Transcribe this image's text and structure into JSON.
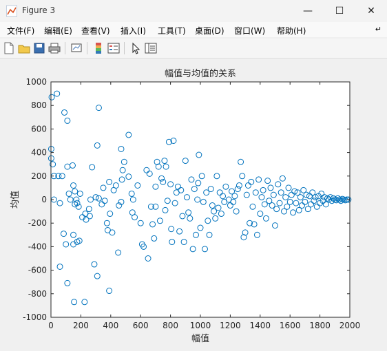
{
  "window": {
    "title": "Figure 3"
  },
  "menu": [
    "文件(F)",
    "编辑(E)",
    "查看(V)",
    "插入(I)",
    "工具(T)",
    "桌面(D)",
    "窗口(W)",
    "帮助(H)"
  ],
  "toolbar": [
    "new-figure-icon",
    "open-file-icon",
    "save-icon",
    "print-icon",
    "link-plot-icon",
    "colorbar-icon",
    "legend-icon",
    "pointer-icon",
    "property-inspector-icon"
  ],
  "colors": {
    "marker": "#0072bd",
    "axes_bg": "#ffffff",
    "figure_bg": "#f0f0f0"
  },
  "chart_data": {
    "type": "scatter",
    "title": "幅值与均值的关系",
    "xlabel": "幅值",
    "ylabel": "均值",
    "xlim": [
      0,
      2000
    ],
    "ylim": [
      -1000,
      1000
    ],
    "xticks": [
      "0",
      "200",
      "400",
      "600",
      "800",
      "1000",
      "1200",
      "1400",
      "1600",
      "1800",
      "2000"
    ],
    "yticks": [
      "1000",
      "800",
      "600",
      "400",
      "200",
      "0",
      "-200",
      "-400",
      "-600",
      "-800",
      "-1000"
    ],
    "marker": "open-circle",
    "grid": false,
    "points": [
      [
        5,
        870
      ],
      [
        40,
        900
      ],
      [
        90,
        740
      ],
      [
        110,
        670
      ],
      [
        320,
        780
      ],
      [
        2,
        430
      ],
      [
        2,
        350
      ],
      [
        12,
        300
      ],
      [
        20,
        200
      ],
      [
        50,
        200
      ],
      [
        75,
        200
      ],
      [
        60,
        -30
      ],
      [
        20,
        0
      ],
      [
        110,
        280
      ],
      [
        145,
        290
      ],
      [
        85,
        -290
      ],
      [
        100,
        -380
      ],
      [
        110,
        -710
      ],
      [
        150,
        -380
      ],
      [
        150,
        -300
      ],
      [
        190,
        -350
      ],
      [
        175,
        -360
      ],
      [
        60,
        -570
      ],
      [
        155,
        -870
      ],
      [
        225,
        -870
      ],
      [
        390,
        -775
      ],
      [
        310,
        -650
      ],
      [
        290,
        -550
      ],
      [
        120,
        50
      ],
      [
        130,
        0
      ],
      [
        150,
        120
      ],
      [
        160,
        70
      ],
      [
        170,
        0
      ],
      [
        175,
        -30
      ],
      [
        160,
        -40
      ],
      [
        185,
        -60
      ],
      [
        195,
        50
      ],
      [
        210,
        -150
      ],
      [
        230,
        -120
      ],
      [
        235,
        -170
      ],
      [
        260,
        -140
      ],
      [
        255,
        -80
      ],
      [
        265,
        0
      ],
      [
        275,
        275
      ],
      [
        300,
        20
      ],
      [
        310,
        460
      ],
      [
        320,
        10
      ],
      [
        340,
        -40
      ],
      [
        350,
        100
      ],
      [
        360,
        -10
      ],
      [
        375,
        -200
      ],
      [
        380,
        -260
      ],
      [
        390,
        150
      ],
      [
        395,
        -120
      ],
      [
        410,
        -280
      ],
      [
        420,
        80
      ],
      [
        435,
        120
      ],
      [
        450,
        -450
      ],
      [
        455,
        -50
      ],
      [
        470,
        -20
      ],
      [
        475,
        170
      ],
      [
        480,
        250
      ],
      [
        490,
        320
      ],
      [
        470,
        430
      ],
      [
        520,
        550
      ],
      [
        520,
        195
      ],
      [
        540,
        50
      ],
      [
        545,
        -110
      ],
      [
        550,
        0
      ],
      [
        560,
        -150
      ],
      [
        580,
        120
      ],
      [
        600,
        -200
      ],
      [
        610,
        -380
      ],
      [
        620,
        -400
      ],
      [
        640,
        250
      ],
      [
        650,
        -500
      ],
      [
        660,
        220
      ],
      [
        670,
        -60
      ],
      [
        680,
        -210
      ],
      [
        690,
        -330
      ],
      [
        700,
        110
      ],
      [
        700,
        -60
      ],
      [
        710,
        320
      ],
      [
        720,
        280
      ],
      [
        730,
        -180
      ],
      [
        740,
        180
      ],
      [
        750,
        150
      ],
      [
        760,
        330
      ],
      [
        765,
        -90
      ],
      [
        770,
        280
      ],
      [
        780,
        -10
      ],
      [
        790,
        490
      ],
      [
        800,
        130
      ],
      [
        805,
        -250
      ],
      [
        810,
        -360
      ],
      [
        820,
        500
      ],
      [
        830,
        -30
      ],
      [
        840,
        60
      ],
      [
        850,
        110
      ],
      [
        860,
        -270
      ],
      [
        870,
        80
      ],
      [
        880,
        -140
      ],
      [
        890,
        -360
      ],
      [
        900,
        330
      ],
      [
        910,
        20
      ],
      [
        920,
        -110
      ],
      [
        930,
        -160
      ],
      [
        940,
        170
      ],
      [
        950,
        -420
      ],
      [
        960,
        90
      ],
      [
        970,
        -300
      ],
      [
        980,
        0
      ],
      [
        985,
        140
      ],
      [
        990,
        380
      ],
      [
        1000,
        -240
      ],
      [
        1010,
        200
      ],
      [
        1020,
        -20
      ],
      [
        1030,
        -420
      ],
      [
        1040,
        60
      ],
      [
        1050,
        -180
      ],
      [
        1060,
        -300
      ],
      [
        1070,
        90
      ],
      [
        1080,
        -50
      ],
      [
        1090,
        -100
      ],
      [
        1100,
        -160
      ],
      [
        1110,
        200
      ],
      [
        1120,
        -70
      ],
      [
        1130,
        60
      ],
      [
        1140,
        -120
      ],
      [
        1150,
        30
      ],
      [
        1160,
        -20
      ],
      [
        1170,
        110
      ],
      [
        1190,
        0
      ],
      [
        1200,
        -50
      ],
      [
        1210,
        70
      ],
      [
        1220,
        -20
      ],
      [
        1230,
        30
      ],
      [
        1240,
        -100
      ],
      [
        1250,
        90
      ],
      [
        1260,
        120
      ],
      [
        1270,
        320
      ],
      [
        1280,
        200
      ],
      [
        1290,
        -320
      ],
      [
        1300,
        -280
      ],
      [
        1310,
        40
      ],
      [
        1320,
        120
      ],
      [
        1330,
        -200
      ],
      [
        1340,
        150
      ],
      [
        1350,
        -60
      ],
      [
        1360,
        -210
      ],
      [
        1370,
        60
      ],
      [
        1380,
        -300
      ],
      [
        1390,
        170
      ],
      [
        1400,
        -120
      ],
      [
        1410,
        20
      ],
      [
        1420,
        80
      ],
      [
        1430,
        -40
      ],
      [
        1440,
        -160
      ],
      [
        1450,
        160
      ],
      [
        1460,
        -10
      ],
      [
        1470,
        100
      ],
      [
        1480,
        -50
      ],
      [
        1490,
        40
      ],
      [
        1500,
        -220
      ],
      [
        1510,
        -80
      ],
      [
        1520,
        130
      ],
      [
        1530,
        -30
      ],
      [
        1540,
        60
      ],
      [
        1550,
        180
      ],
      [
        1560,
        -100
      ],
      [
        1570,
        20
      ],
      [
        1580,
        -60
      ],
      [
        1590,
        100
      ],
      [
        1600,
        -20
      ],
      [
        1610,
        40
      ],
      [
        1620,
        -110
      ],
      [
        1630,
        70
      ],
      [
        1640,
        -30
      ],
      [
        1650,
        60
      ],
      [
        1660,
        -90
      ],
      [
        1670,
        20
      ],
      [
        1680,
        -50
      ],
      [
        1690,
        80
      ],
      [
        1700,
        -20
      ],
      [
        1710,
        40
      ],
      [
        1720,
        -80
      ],
      [
        1730,
        30
      ],
      [
        1740,
        -40
      ],
      [
        1750,
        60
      ],
      [
        1760,
        -10
      ],
      [
        1770,
        20
      ],
      [
        1780,
        -60
      ],
      [
        1790,
        30
      ],
      [
        1800,
        -30
      ],
      [
        1810,
        50
      ],
      [
        1820,
        -10
      ],
      [
        1830,
        20
      ],
      [
        1840,
        -40
      ],
      [
        1850,
        10
      ],
      [
        1860,
        0
      ],
      [
        1870,
        20
      ],
      [
        1880,
        -10
      ],
      [
        1890,
        10
      ],
      [
        1900,
        0
      ],
      [
        1910,
        -5
      ],
      [
        1920,
        10
      ],
      [
        1930,
        0
      ],
      [
        1940,
        -10
      ],
      [
        1950,
        5
      ],
      [
        1960,
        0
      ],
      [
        1970,
        -5
      ],
      [
        1980,
        0
      ],
      [
        1990,
        0
      ]
    ]
  }
}
